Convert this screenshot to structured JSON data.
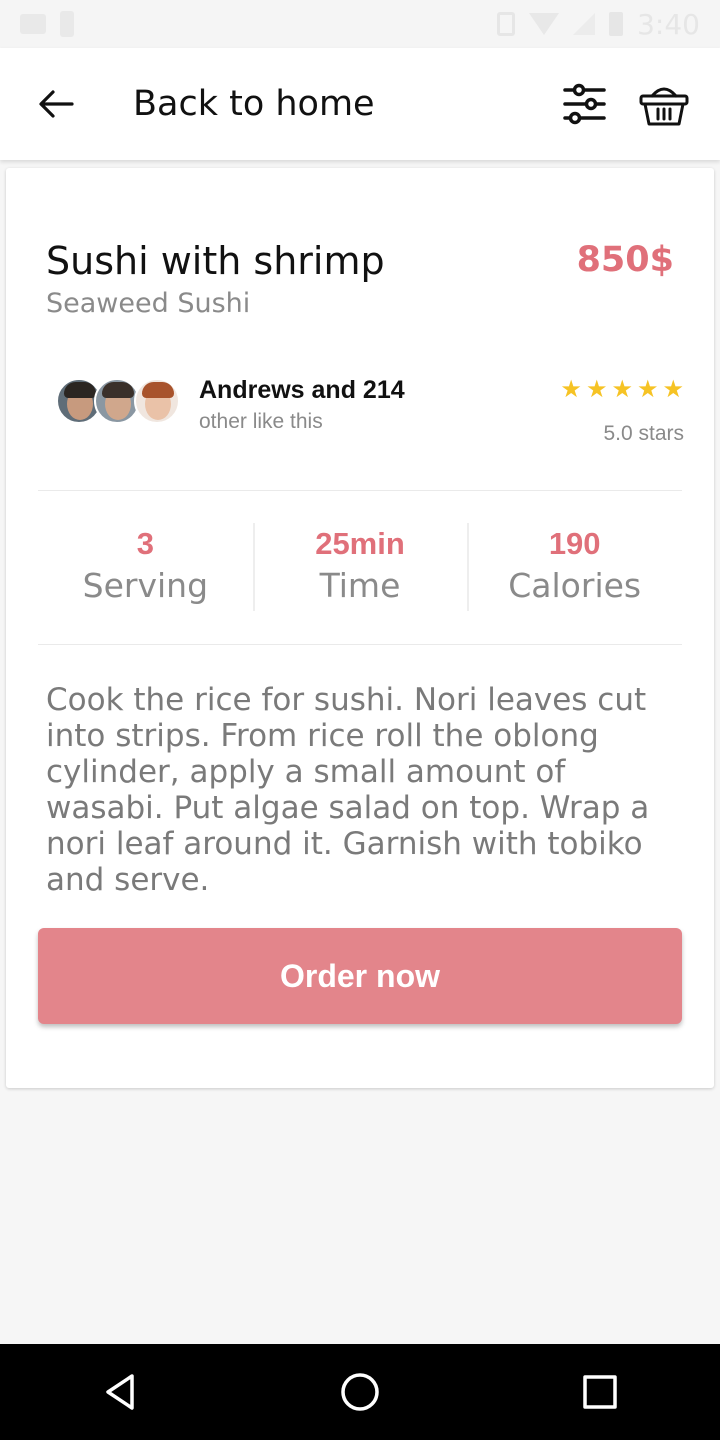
{
  "status_bar": {
    "time": "3:40",
    "icons": [
      "image-icon",
      "phone-icon",
      "vibrate-icon",
      "wifi-icon",
      "signal-icon",
      "battery-icon"
    ]
  },
  "app_bar": {
    "title": "Back to home",
    "back_icon": "arrow-left-icon",
    "filter_icon": "sliders-icon",
    "basket_icon": "basket-icon"
  },
  "dish": {
    "name": "Sushi with shrimp",
    "subtitle": "Seaweed Sushi",
    "price": "850$"
  },
  "likes": {
    "name": "Andrews and 214",
    "sub": "other like this",
    "avatars": [
      "avatar-man-1",
      "avatar-man-2",
      "avatar-woman"
    ]
  },
  "rating": {
    "stars": 5,
    "max": 5,
    "label": "5.0 stars"
  },
  "stats": [
    {
      "value": "3",
      "label": "Serving"
    },
    {
      "value": "25min",
      "label": "Time"
    },
    {
      "value": "190",
      "label": "Calories"
    }
  ],
  "description": "Cook the rice for sushi. Nori leaves cut into strips. From rice roll the oblong cylinder, apply a small amount of wasabi. Put algae salad on top. Wrap a nori leaf around it. Garnish with tobiko and serve.",
  "order_button": "Order now",
  "colors": {
    "accent": "#e0707a",
    "button": "#e3858b",
    "star": "#f6c324"
  },
  "nav_bar": {
    "icons": [
      "back-triangle-icon",
      "home-circle-icon",
      "recents-square-icon"
    ]
  }
}
